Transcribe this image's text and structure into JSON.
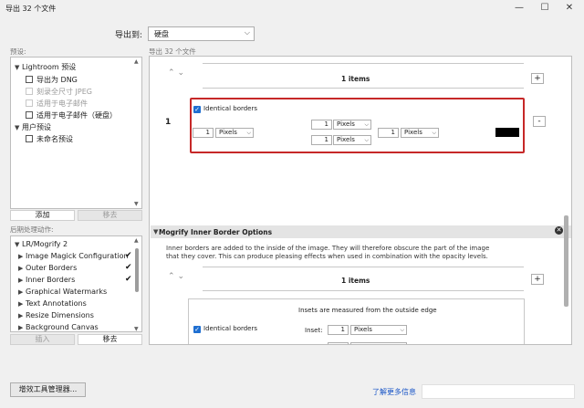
{
  "window": {
    "title": "导出 32 个文件",
    "min": "—",
    "max": "☐",
    "close": "✕"
  },
  "export_to": {
    "label": "导出到:",
    "value": "硬盘"
  },
  "presets": {
    "label": "预设:",
    "groups": [
      {
        "name": "Lightroom 预设",
        "items": [
          {
            "label": "导出为 DNG",
            "dim": false
          },
          {
            "label": "刻录全尺寸 JPEG",
            "dim": true
          },
          {
            "label": "适用于电子邮件",
            "dim": true
          },
          {
            "label": "适用于电子邮件（硬盘）",
            "dim": false
          }
        ]
      },
      {
        "name": "用户预设",
        "items": [
          {
            "label": "未命名预设",
            "dim": false
          }
        ]
      }
    ],
    "add_button": "添加",
    "remove_button": "移去"
  },
  "post_process": {
    "label": "后期处理动作:",
    "group": "LR/Mogrify 2",
    "items": [
      {
        "label": "Image Magick Configuration",
        "checked": true
      },
      {
        "label": "Outer Borders",
        "checked": true
      },
      {
        "label": "Inner Borders",
        "checked": true
      },
      {
        "label": "Graphical Watermarks",
        "checked": false
      },
      {
        "label": "Text Annotations",
        "checked": false
      },
      {
        "label": "Resize Dimensions",
        "checked": false
      },
      {
        "label": "Background Canvas",
        "checked": false
      }
    ],
    "insert_button": "插入",
    "remove_button": "移去"
  },
  "main": {
    "header": "导出 32 个文件",
    "outer": {
      "items_label": "1 items",
      "row_number": "1",
      "identical_label": "Identical borders",
      "values": [
        "1",
        "1",
        "1",
        "1"
      ],
      "unit": "Pixels",
      "swatch_color": "#000000"
    },
    "inner_section": {
      "title": "Mogrify Inner Border Options",
      "desc_line1": "Inner borders are added to the inside of the image.  They will therefore obscure the part of the image",
      "desc_line2": "that they cover.  This can produce pleasing effects when used in combination with the opacity levels.",
      "items_label": "1 items",
      "insets_note": "Insets are measured from the outside edge",
      "identical_label": "Identical borders",
      "inset_label": "Inset:",
      "inset_value": "1",
      "unit": "Pixels"
    }
  },
  "footer": {
    "plugin_manager": "增效工具管理器...",
    "more_info": "了解更多信息"
  },
  "colors": {
    "highlight": "#c62828",
    "link": "#1a56c7",
    "checkbox": "#1f6fd1"
  }
}
